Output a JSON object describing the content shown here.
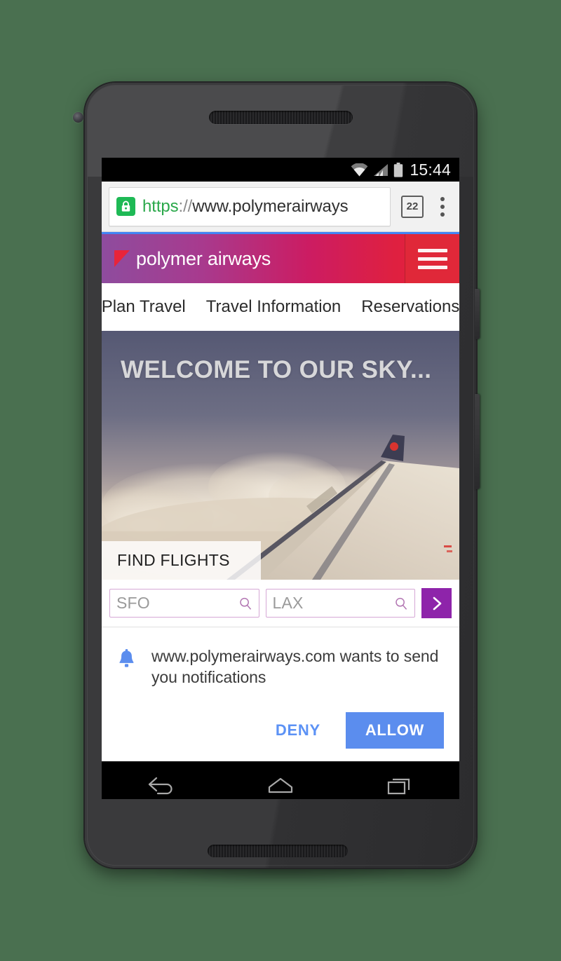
{
  "device": {
    "type": "android-phone",
    "status_bar": {
      "clock": "15:44",
      "icons": [
        "wifi-icon",
        "signal-icon",
        "battery-icon"
      ]
    },
    "nav_bar": {
      "back_label": "Back",
      "home_label": "Home",
      "recents_label": "Recent apps"
    }
  },
  "browser": {
    "url_scheme": "https",
    "url_separator": "://",
    "url_host": "www.polymerairways",
    "security_icon": "lock-icon",
    "tab_count": "22",
    "overflow_label": "More options"
  },
  "site": {
    "brand": "polymer airways",
    "menu_label": "Menu",
    "nav": [
      {
        "label": "Plan Travel"
      },
      {
        "label": "Travel Information"
      },
      {
        "label": "Reservations"
      }
    ],
    "hero": {
      "title": "WELCOME TO OUR SKY...",
      "tab_label": "FIND FLIGHTS"
    },
    "search": {
      "origin_value": "SFO",
      "origin_placeholder": "SFO",
      "destination_value": "LAX",
      "destination_placeholder": "LAX",
      "submit_label": "Search flights"
    }
  },
  "permission_dialog": {
    "icon": "bell-icon",
    "message": "www.polymerairways.com wants to send you notifications",
    "deny_label": "DENY",
    "allow_label": "ALLOW"
  },
  "colors": {
    "page_background": "#4a7050",
    "brand_gradient_start": "#8e4c9e",
    "brand_gradient_mid": "#cc1c62",
    "brand_gradient_end": "#e8243a",
    "accent_purple": "#8e24aa",
    "allow_blue": "#5b8dee",
    "deny_blue": "#5c92f5",
    "secure_green": "#1eb955",
    "progress_blue": "#4285f4"
  }
}
